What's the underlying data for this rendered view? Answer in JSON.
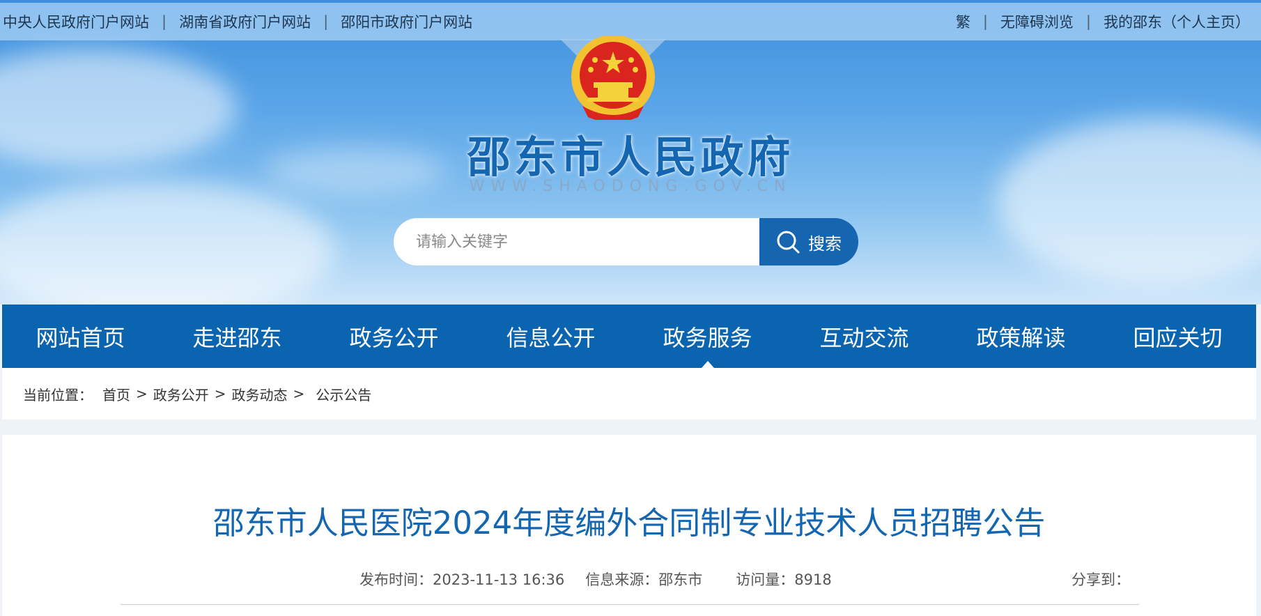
{
  "topbar": {
    "left_links": [
      "中央人民政府门户网站",
      "湖南省政府门户网站",
      "邵阳市政府门户网站"
    ],
    "right_links": [
      "繁",
      "无障碍浏览",
      "我的邵东（个人主页）"
    ],
    "separator": "|"
  },
  "header": {
    "title": "邵东市人民政府",
    "url": "WWW.SHAODONG.GOV.CN",
    "emblem": "national-emblem"
  },
  "search": {
    "placeholder": "请输入关键字",
    "value": "",
    "button_label": "搜索",
    "icon": "search-icon"
  },
  "nav": {
    "items": [
      "网站首页",
      "走进邵东",
      "政务公开",
      "信息公开",
      "政务服务",
      "互动交流",
      "政策解读",
      "回应关切"
    ],
    "active_index": 4
  },
  "breadcrumb": {
    "prefix": "当前位置：",
    "items": [
      "首页",
      "政务公开",
      "政务动态",
      "公示公告"
    ],
    "arrow": ">"
  },
  "article": {
    "title": "邵东市人民医院2024年度编外合同制专业技术人员招聘公告",
    "publish_time": "发布时间：2023-11-13 16:36",
    "source": "信息来源：邵东市",
    "views": "访问量：8918",
    "share_label": "分享到："
  },
  "colors": {
    "primary_blue": "#0b64b0",
    "title_blue": "#1566b0",
    "emblem_red": "#d9251d",
    "emblem_gold": "#f2c230"
  }
}
